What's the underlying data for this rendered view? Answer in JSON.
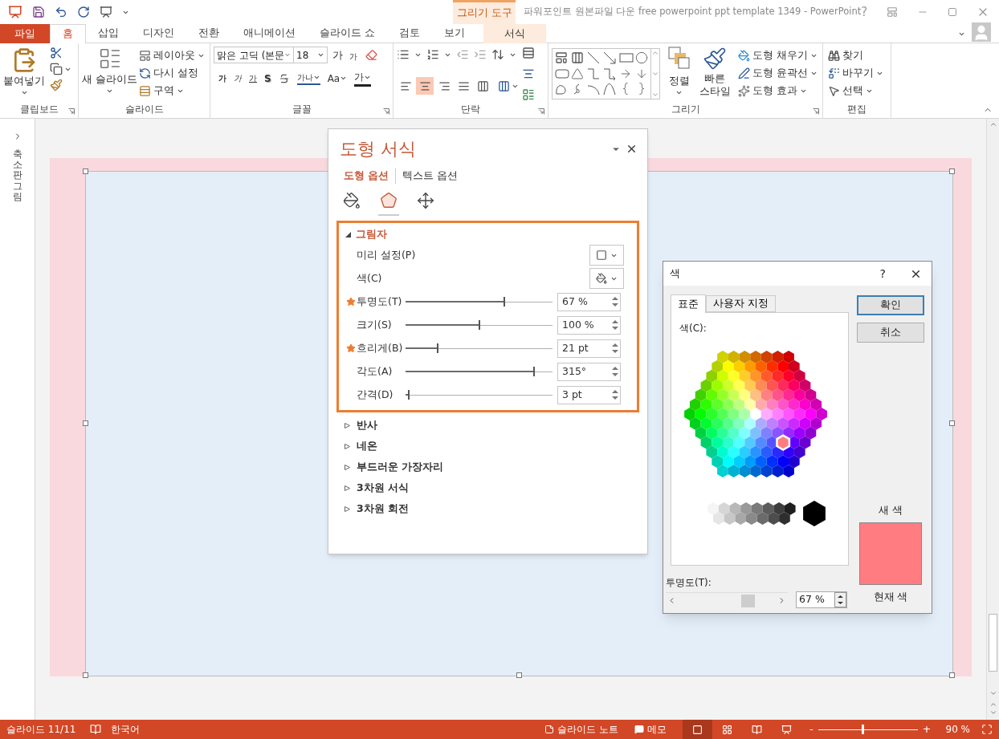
{
  "title_bar": {
    "title": "파워포인트 원본파일 다운 free powerpoint ppt template 1349 - PowerPoint",
    "contextual_label": "그리기 도구",
    "help": "?"
  },
  "ribbon_tabs": [
    {
      "label": "파일",
      "kind": "file",
      "selected": false
    },
    {
      "label": "홈",
      "kind": "tab",
      "selected": true
    },
    {
      "label": "삽입",
      "kind": "tab",
      "selected": false
    },
    {
      "label": "디자인",
      "kind": "tab",
      "selected": false
    },
    {
      "label": "전환",
      "kind": "tab",
      "selected": false
    },
    {
      "label": "애니메이션",
      "kind": "tab",
      "selected": false
    },
    {
      "label": "슬라이드 쇼",
      "kind": "tab",
      "selected": false
    },
    {
      "label": "검토",
      "kind": "tab",
      "selected": false
    },
    {
      "label": "보기",
      "kind": "tab",
      "selected": false
    },
    {
      "label": "서식",
      "kind": "contextual",
      "selected": false
    }
  ],
  "clipboard": {
    "label": "클립보드",
    "paste": "붙여넣기"
  },
  "slides_group": {
    "label": "슬라이드",
    "new_slide": "새 슬라이드",
    "layout": "레이아웃",
    "reset": "다시 설정",
    "section": "구역"
  },
  "font_group": {
    "label": "글꼴",
    "font": "맑은 고딕 (본문",
    "size": "18",
    "grow": "가",
    "shrink": "가",
    "bold": "가",
    "italic": "가",
    "underline": "가",
    "shadow": "S",
    "spacing": "가나",
    "case": "Aa",
    "font_color_label": "가"
  },
  "paragraph_group": {
    "label": "단락",
    "alignment": [
      {
        "kind": "left",
        "selected": false
      },
      {
        "kind": "center",
        "selected": true
      },
      {
        "kind": "right",
        "selected": false
      },
      {
        "kind": "justify",
        "selected": false
      },
      {
        "kind": "distributed",
        "selected": false
      }
    ]
  },
  "drawing_group": {
    "label": "그리기",
    "arrange": "정렬",
    "quick_styles": "빠른 스타일",
    "fill": "도형 채우기",
    "outline": "도형 윤곽선",
    "effects": "도형 효과"
  },
  "editing_group": {
    "label": "편집",
    "find": "찾기",
    "replace": "바꾸기",
    "select": "선택"
  },
  "thumbnail_pane": {
    "label": "축소판 그림"
  },
  "format_pane": {
    "title": "도형 서식",
    "tabs": [
      {
        "label": "도형 옵션",
        "selected": true
      },
      {
        "label": "텍스트 옵션",
        "selected": false
      }
    ],
    "icon_tabs": [
      {
        "kind": "fill",
        "selected": false
      },
      {
        "kind": "effects",
        "selected": true
      },
      {
        "kind": "size",
        "selected": false
      }
    ],
    "shadow": {
      "label": "그림자",
      "expanded": true,
      "highlighted": true,
      "rows": [
        {
          "kind": "preset",
          "label": "미리 설정(P)",
          "marked": false
        },
        {
          "kind": "color",
          "label": "색(C)",
          "marked": false
        },
        {
          "kind": "slider",
          "label": "투명도(T)",
          "level": 0.67,
          "value": "67 %",
          "marked": true
        },
        {
          "kind": "slider",
          "label": "크기(S)",
          "level": 0.5,
          "value": "100 %",
          "marked": false
        },
        {
          "kind": "slider",
          "label": "흐리게(B)",
          "level": 0.22,
          "value": "21 pt",
          "marked": true
        },
        {
          "kind": "slider",
          "label": "각도(A)",
          "level": 0.875,
          "value": "315°",
          "marked": false
        },
        {
          "kind": "slider",
          "label": "간격(D)",
          "level": 0.02,
          "value": "3 pt",
          "marked": false
        }
      ]
    },
    "sections": [
      {
        "label": "반사",
        "expanded": false
      },
      {
        "label": "네온",
        "expanded": false
      },
      {
        "label": "부드러운 가장자리",
        "expanded": false
      },
      {
        "label": "3차원 서식",
        "expanded": false
      },
      {
        "label": "3차원 회전",
        "expanded": false
      }
    ]
  },
  "color_dialog": {
    "title": "색",
    "help": "?",
    "tabs": [
      {
        "label": "표준",
        "selected": true
      },
      {
        "label": "사용자 지정",
        "selected": false
      }
    ],
    "colors_label": "색(C):",
    "ok": "확인",
    "cancel": "취소",
    "new_label": "새 색",
    "new_swatch": {
      "color": "#ff7c80"
    },
    "current_label": "현재 색",
    "transparency_label": "투명도(T):",
    "transparency": {
      "level": 0.67
    },
    "transparency_value": "67 %"
  },
  "status_bar": {
    "slide": "슬라이드 11/11",
    "language": "한국어",
    "notes": "슬라이드 노트",
    "comments": "메모",
    "views": [
      {
        "kind": "normal",
        "selected": true
      },
      {
        "kind": "sorter",
        "selected": false
      },
      {
        "kind": "reading",
        "selected": false
      },
      {
        "kind": "slideshow",
        "selected": false
      }
    ],
    "zoom_out": "-",
    "zoom_in": "+",
    "zoom_slider": {
      "level": 0.45
    },
    "zoom": "90 %"
  }
}
